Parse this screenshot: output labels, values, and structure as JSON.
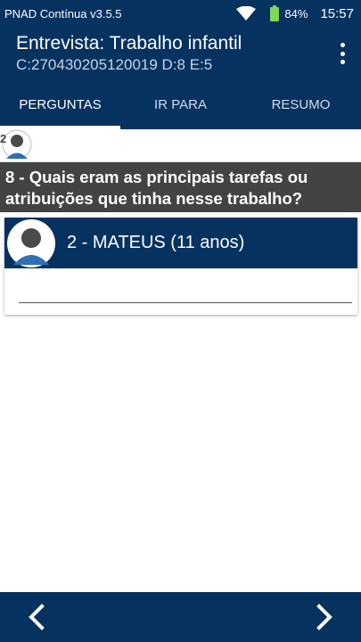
{
  "status_bar": {
    "app_name": "PNAD Contínua v3.5.5",
    "battery_percent": "84%",
    "time": "15:57",
    "battery_level": 0.84
  },
  "header": {
    "title": "Entrevista: Trabalho infantil",
    "subtitle": "C:270430205120019 D:8 E:5"
  },
  "tabs": [
    {
      "label": "PERGUNTAS",
      "active": true
    },
    {
      "label": "IR PARA",
      "active": false
    },
    {
      "label": "RESUMO",
      "active": false
    }
  ],
  "respondent_strip": {
    "number": "2"
  },
  "question": {
    "text": "8 - Quais eram as principais tarefas ou atribuições que tinha nesse trabalho?"
  },
  "person_card": {
    "name": "2 - MATEUS (11 anos)",
    "answer_value": "",
    "answer_placeholder": ""
  },
  "colors": {
    "primary": "#063260",
    "question_bg": "#434343",
    "battery": "#7ed957"
  }
}
